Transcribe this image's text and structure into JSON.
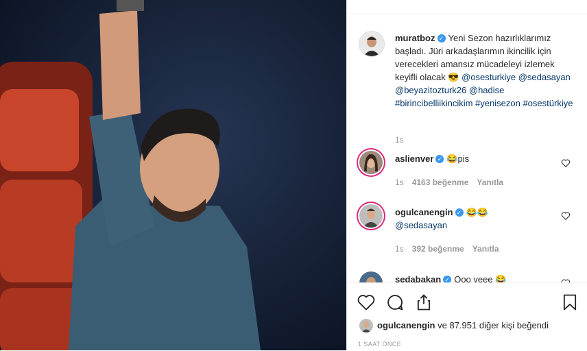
{
  "post": {
    "author": "muratboz",
    "caption_text": "Yeni Sezon hazırlıklarımız başladı. Jüri arkadaşlarımın ikincilik için verecekleri amansız mücadeleyi izlemek keyifli olacak 😎",
    "tags": [
      "@osesturkiye",
      "@sedasayan",
      "@beyazitozturk26",
      "@hadise",
      "#birincibelliikincikim",
      "#yenisezon",
      "#osestürkiye"
    ],
    "age": "1s"
  },
  "comments": [
    {
      "user": "aslienver",
      "text": "😂pis",
      "age": "1s",
      "likes": "4163 beğenme",
      "reply": "Yanıtla"
    },
    {
      "user": "ogulcanengin",
      "text": "😂😂",
      "mention": "@sedasayan",
      "age": "1s",
      "likes": "392 beğenme",
      "reply": "Yanıtla"
    },
    {
      "user": "sedabakan",
      "text": "Ooo veee 😂"
    }
  ],
  "likes_bar": {
    "user": "ogulcanengin",
    "rest": "ve 87.951 diğer kişi beğendi"
  },
  "timestamp": "1 SAAT ÖNCE",
  "icons": [
    "heart-icon",
    "comment-icon",
    "share-icon",
    "bookmark-icon"
  ],
  "colors": {
    "link": "#003569",
    "verified": "#3897f0",
    "muted": "#999999",
    "text": "#262626"
  }
}
